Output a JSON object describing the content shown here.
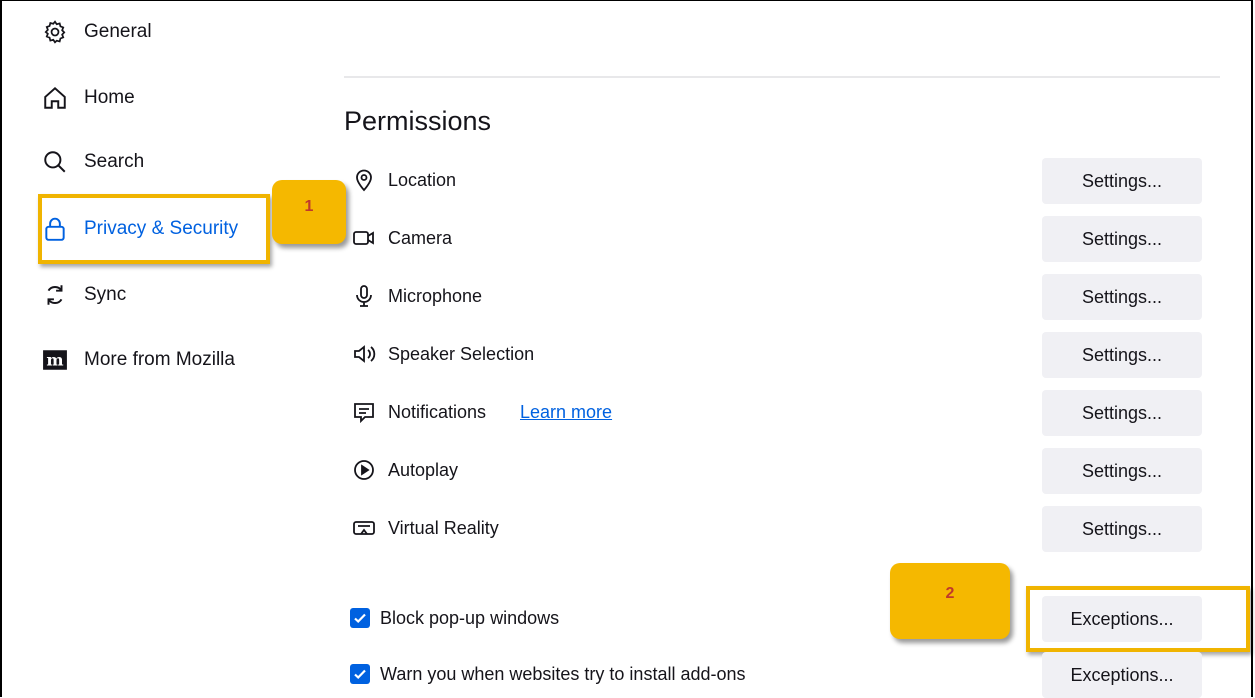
{
  "sidebar": {
    "items": [
      {
        "label": "General",
        "icon": "gear-icon"
      },
      {
        "label": "Home",
        "icon": "home-icon"
      },
      {
        "label": "Search",
        "icon": "search-icon"
      },
      {
        "label": "Privacy & Security",
        "icon": "lock-icon"
      },
      {
        "label": "Sync",
        "icon": "sync-icon"
      },
      {
        "label": "More from Mozilla",
        "icon": "mozilla-icon"
      }
    ]
  },
  "annotations": {
    "step1": "1",
    "step2": "2",
    "highlight_color": "#f5b800"
  },
  "permissions": {
    "title": "Permissions",
    "rows": [
      {
        "label": "Location",
        "icon": "location-icon",
        "button": "Settings..."
      },
      {
        "label": "Camera",
        "icon": "camera-icon",
        "button": "Settings..."
      },
      {
        "label": "Microphone",
        "icon": "microphone-icon",
        "button": "Settings..."
      },
      {
        "label": "Speaker Selection",
        "icon": "speaker-icon",
        "button": "Settings..."
      },
      {
        "label": "Notifications",
        "icon": "notification-icon",
        "button": "Settings...",
        "link": "Learn more"
      },
      {
        "label": "Autoplay",
        "icon": "autoplay-icon",
        "button": "Settings..."
      },
      {
        "label": "Virtual Reality",
        "icon": "vr-icon",
        "button": "Settings..."
      }
    ],
    "checkboxes": [
      {
        "label": "Block pop-up windows",
        "checked": true,
        "button": "Exceptions..."
      },
      {
        "label": "Warn you when websites try to install add-ons",
        "checked": true,
        "button": "Exceptions..."
      }
    ]
  },
  "colors": {
    "accent": "#0061e0",
    "button_bg": "#f0f0f4"
  }
}
